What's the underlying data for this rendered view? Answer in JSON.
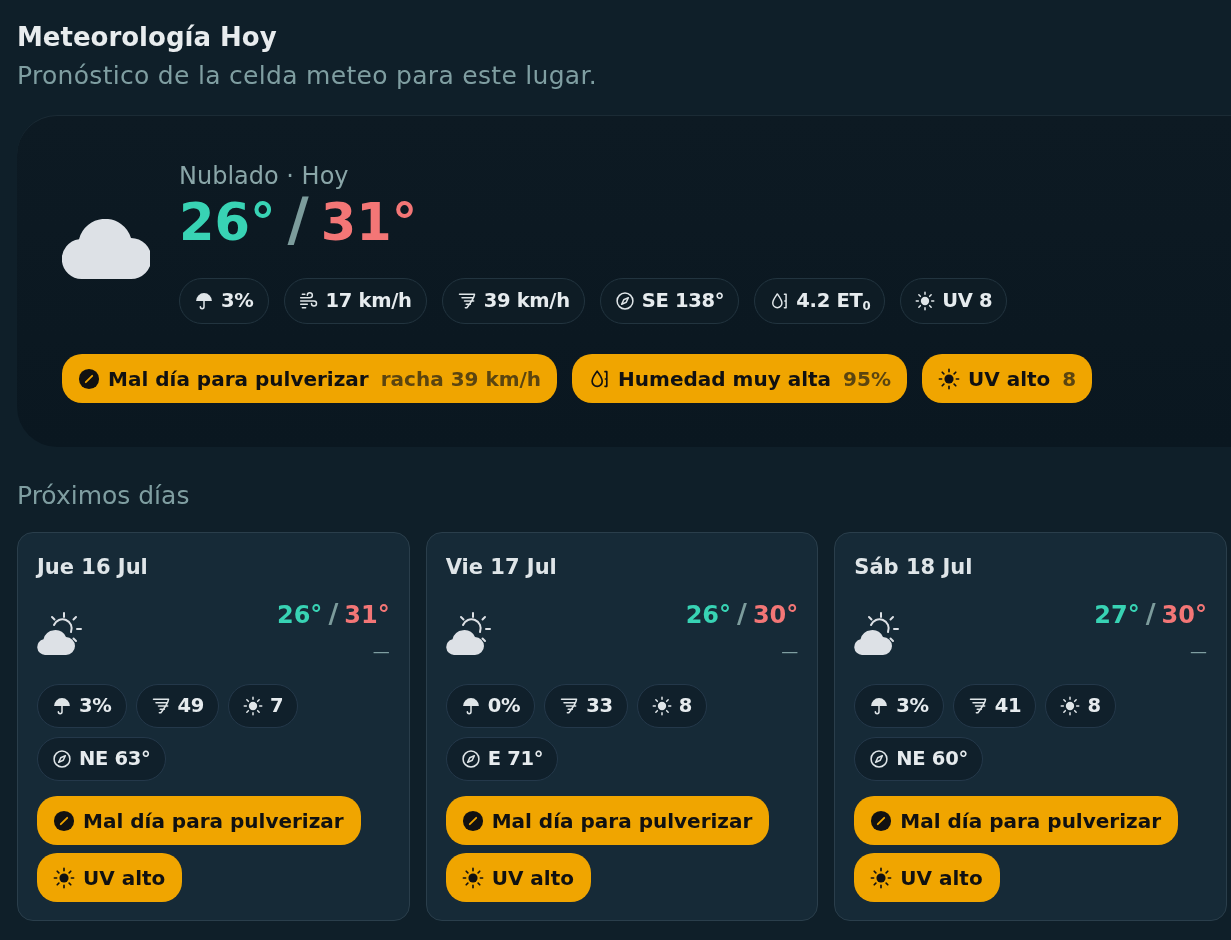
{
  "header": {
    "title": "Meteorología Hoy",
    "subtitle": "Pronóstico de la celda meteo para este lugar."
  },
  "today": {
    "kind": "cloudy",
    "condition": "Nublado · Hoy",
    "temp_min": "26°",
    "separator": "/",
    "temp_max": "31°",
    "metrics": [
      {
        "kind": "rain",
        "text": "3%"
      },
      {
        "kind": "wind",
        "text": "17 km/h"
      },
      {
        "kind": "gust",
        "text": "39 km/h"
      },
      {
        "kind": "direction",
        "text": "SE 138°"
      },
      {
        "kind": "et0",
        "text": "4.2 ET$_{0}$"
      },
      {
        "kind": "uv",
        "text": "UV 8"
      }
    ],
    "alerts": [
      {
        "kind": "spray",
        "label": "Mal día para pulverizar",
        "detail": "racha 39 km/h"
      },
      {
        "kind": "humidity",
        "label": "Humedad muy alta",
        "detail": "95%"
      },
      {
        "kind": "uv",
        "label": "UV alto",
        "detail": "8"
      }
    ]
  },
  "forecast": {
    "title": "Próximos días",
    "days": [
      {
        "kind": "partly_cloudy",
        "date": "Jue 16 Jul",
        "temp_min": "26°",
        "separator": "/",
        "temp_max": "31°",
        "note": "—",
        "metrics": [
          {
            "kind": "rain",
            "text": "3%"
          },
          {
            "kind": "gust",
            "text": "49"
          },
          {
            "kind": "uv",
            "text": "7"
          },
          {
            "kind": "direction",
            "text": "NE 63°"
          }
        ],
        "alerts": [
          {
            "kind": "spray",
            "label": "Mal día para pulverizar"
          },
          {
            "kind": "uv",
            "label": "UV alto"
          }
        ]
      },
      {
        "kind": "partly_cloudy",
        "date": "Vie 17 Jul",
        "temp_min": "26°",
        "separator": "/",
        "temp_max": "30°",
        "note": "—",
        "metrics": [
          {
            "kind": "rain",
            "text": "0%"
          },
          {
            "kind": "gust",
            "text": "33"
          },
          {
            "kind": "uv",
            "text": "8"
          },
          {
            "kind": "direction",
            "text": "E 71°"
          }
        ],
        "alerts": [
          {
            "kind": "spray",
            "label": "Mal día para pulverizar"
          },
          {
            "kind": "uv",
            "label": "UV alto"
          }
        ]
      },
      {
        "kind": "partly_cloudy",
        "date": "Sáb 18 Jul",
        "temp_min": "27°",
        "separator": "/",
        "temp_max": "30°",
        "note": "—",
        "metrics": [
          {
            "kind": "rain",
            "text": "3%"
          },
          {
            "kind": "gust",
            "text": "41"
          },
          {
            "kind": "uv",
            "text": "8"
          },
          {
            "kind": "direction",
            "text": "NE 60°"
          }
        ],
        "alerts": [
          {
            "kind": "spray",
            "label": "Mal día para pulverizar"
          },
          {
            "kind": "uv",
            "label": "UV alto"
          }
        ]
      }
    ]
  }
}
